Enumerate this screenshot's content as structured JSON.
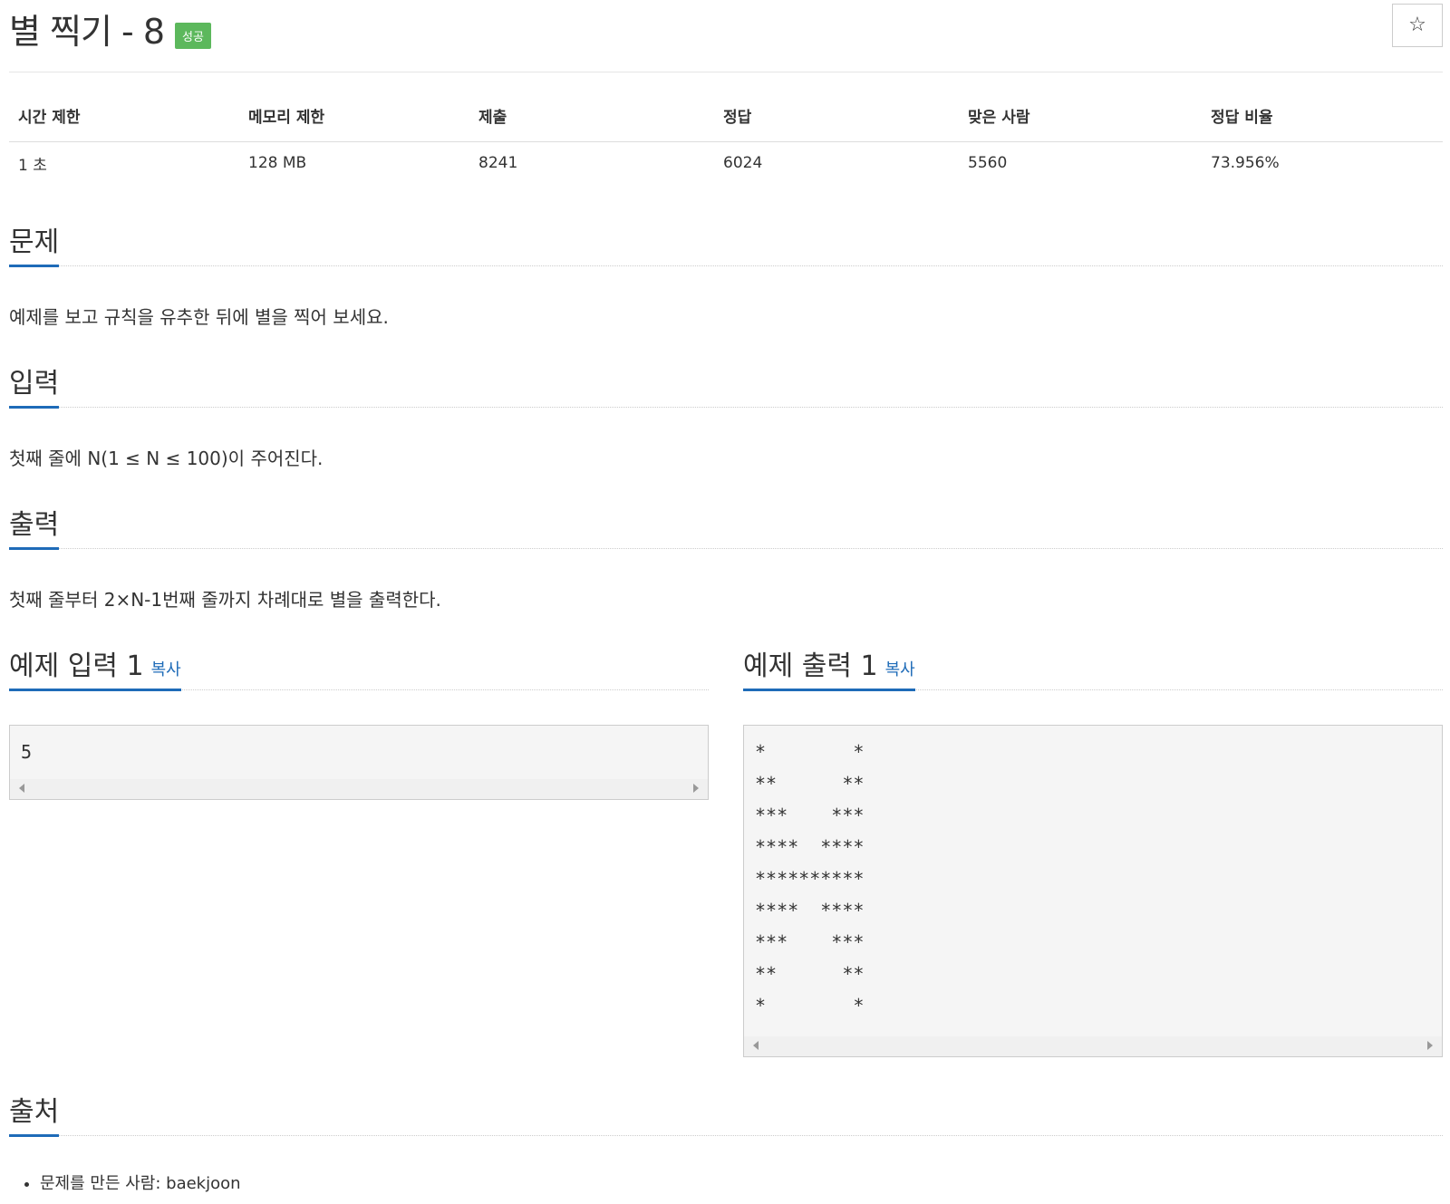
{
  "problem": {
    "title": "별 찍기 - 8",
    "badge": "성공",
    "star": "☆"
  },
  "info_table": {
    "headers": [
      "시간 제한",
      "메모리 제한",
      "제출",
      "정답",
      "맞은 사람",
      "정답 비율"
    ],
    "values": [
      "1 초",
      "128 MB",
      "8241",
      "6024",
      "5560",
      "73.956%"
    ]
  },
  "sections": {
    "problem_heading": "문제",
    "problem_text": "예제를 보고 규칙을 유추한 뒤에 별을 찍어 보세요.",
    "input_heading": "입력",
    "input_text": "첫째 줄에 N(1 ≤ N ≤ 100)이 주어진다.",
    "output_heading": "출력",
    "output_text": "첫째 줄부터 2×N-1번째 줄까지 차례대로 별을 출력한다.",
    "sample_input_heading": "예제 입력 1",
    "sample_output_heading": "예제 출력 1",
    "copy_label": "복사",
    "source_heading": "출처",
    "source_item": "문제를 만든 사람: baekjoon"
  },
  "sample_input": [
    "5"
  ],
  "sample_output": [
    "*        *",
    "**      **",
    "***    ***",
    "****  ****",
    "**********",
    "****  ****",
    "***    ***",
    "**      **",
    "*        *"
  ]
}
